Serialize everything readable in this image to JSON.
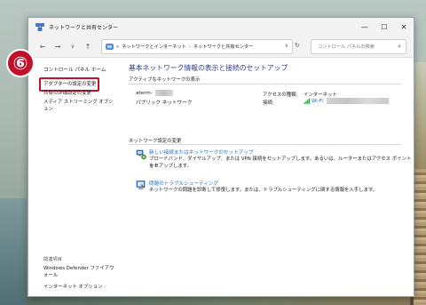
{
  "window": {
    "title": "ネットワークと共有センター",
    "controls": {
      "minimize": "—",
      "maximize": "☐",
      "close": "✕"
    }
  },
  "nav": {
    "back": "←",
    "forward": "→",
    "history": "∨",
    "up": "↑",
    "address_prefix": "«",
    "breadcrumb": [
      "ネットワークとインターネット",
      "ネットワークと共有センター"
    ],
    "separator": "›",
    "dropdown": "∨",
    "refresh": "↻",
    "search_placeholder": "コントロール パネルの検索",
    "search_icon": "⌕"
  },
  "left_pane": {
    "home": "コントロール パネル ホーム",
    "links": [
      "アダプターの設定の変更",
      "共有の詳細設定の変更",
      "メディア ストリーミング オプション"
    ],
    "related_header": "関連項目",
    "related_links": [
      "Windows Defender ファイアウォール",
      "インターネット オプション"
    ]
  },
  "step_badge": "⑥",
  "main": {
    "title": "基本ネットワーク情報の表示と接続のセットアップ",
    "active_header": "アクティブなネットワークの表示",
    "network_name": "aterm-",
    "network_type": "パブリック ネットワーク",
    "access_type_label": "アクセスの種類:",
    "access_type_value": "インターネット",
    "connection_label": "接続:",
    "connection_value": "Wi-Fi",
    "change_header": "ネットワーク設定の変更",
    "tasks": [
      {
        "link": "新しい接続またはネットワークのセットアップ",
        "desc": [
          "ブロードバンド、ダイヤルアップ、または VPN 接続をセットアップします。あるいは、ルーターまたはアクセス ポイントをセ",
          "ットアップします。"
        ],
        "icon": "network-setup-icon"
      },
      {
        "link": "問題のトラブルシューティング",
        "desc": [
          "ネットワークの問題を診断して修復します。または、トラブルシューティングに関する情報を入手します。"
        ],
        "icon": "troubleshoot-icon"
      }
    ]
  },
  "colors": {
    "accent_blue": "#1f6fc0",
    "title_blue": "#2a3e8a",
    "highlight_red": "#c0122b"
  }
}
